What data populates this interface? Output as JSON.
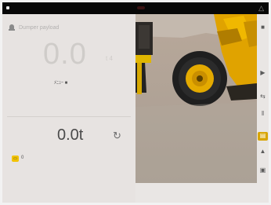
{
  "status": {
    "right_glyph": "△"
  },
  "left_panel": {
    "title": "Dumper payload",
    "big_weight": "0.0",
    "big_unit": "t 4",
    "small_label": "ﾒﾆｭｰ ■",
    "weight_value": "0.0t",
    "refresh_glyph": "↻",
    "badge_text": "▭",
    "badge_count": "0"
  },
  "right_rail": {
    "icons": [
      "■",
      "▶",
      "⇆",
      "‖",
      "▤",
      "▲",
      "▣"
    ]
  },
  "colors": {
    "accent": "#d8a400",
    "statusbar": "#070707"
  }
}
